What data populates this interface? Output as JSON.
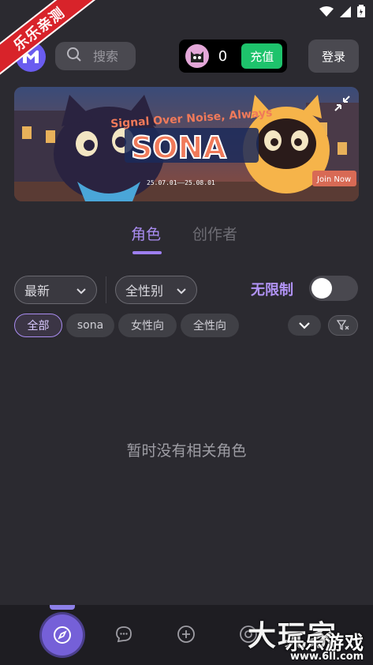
{
  "watermark": {
    "ribbon_text": "乐乐亲测",
    "big_text": "大玩家",
    "small_text": "乐乐游戏",
    "url": "www.6ll.com"
  },
  "header": {
    "search_placeholder": "搜索",
    "coin_count": "0",
    "recharge_label": "充值",
    "login_label": "登录"
  },
  "banner": {
    "slogan": "Signal Over Noise, Always",
    "title": "SONA",
    "dates": "25.07.01——25.08.01",
    "cta": "Join Now"
  },
  "tabs": {
    "active": "角色",
    "inactive": "创作者"
  },
  "filters": {
    "sort_value": "最新",
    "gender_value": "全性别",
    "nolimit_label": "无限制",
    "nolimit_enabled": false
  },
  "chips": [
    {
      "label": "全部",
      "active": true
    },
    {
      "label": "sona",
      "active": false
    },
    {
      "label": "女性向",
      "active": false
    },
    {
      "label": "全性向",
      "active": false
    }
  ],
  "empty_message": "暂时没有相关角色",
  "colors": {
    "accent": "#a98cf0",
    "recharge": "#1ec36c",
    "background": "#2b2a30"
  },
  "nav": {
    "items": [
      "compass-icon",
      "chat-icon",
      "plus-circle-icon",
      "support-icon"
    ]
  }
}
